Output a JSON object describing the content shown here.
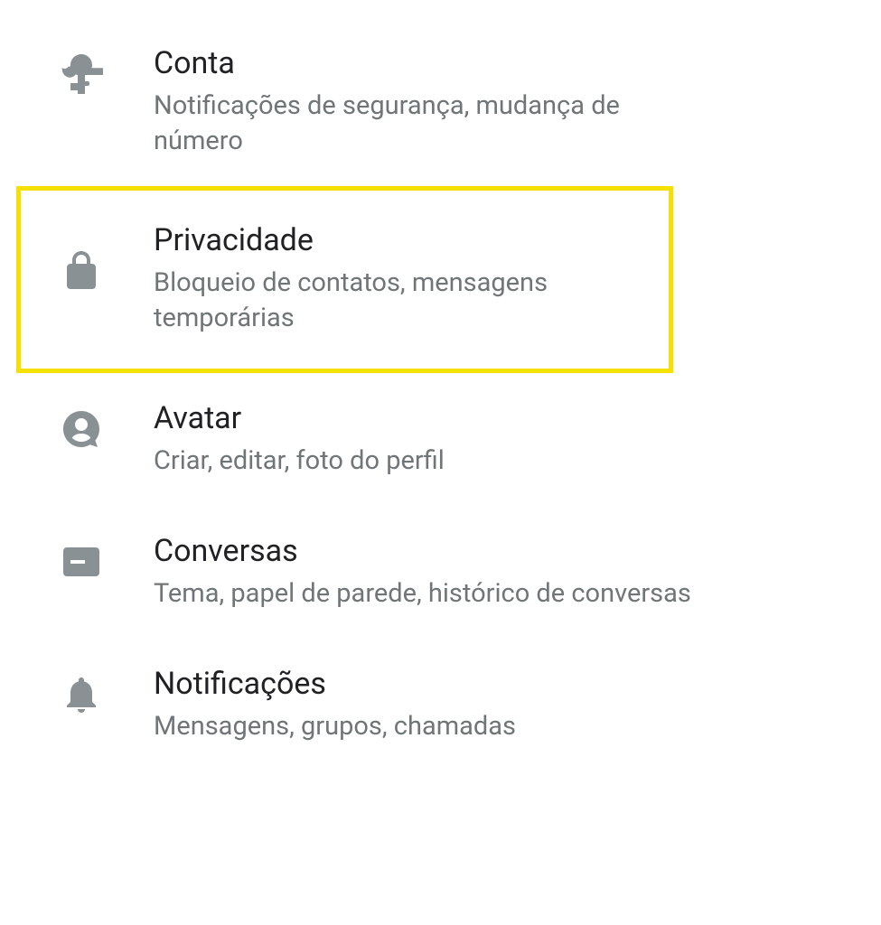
{
  "settings": {
    "items": [
      {
        "title": "Conta",
        "description": "Notificações de segurança, mudança de número",
        "icon": "key"
      },
      {
        "title": "Privacidade",
        "description": "Bloqueio de contatos, mensagens temporárias",
        "icon": "lock",
        "highlighted": true
      },
      {
        "title": "Avatar",
        "description": "Criar, editar, foto do perfil",
        "icon": "avatar"
      },
      {
        "title": "Conversas",
        "description": "Tema, papel de parede, histórico de conversas",
        "icon": "chat"
      },
      {
        "title": "Notificações",
        "description": "Mensagens, grupos, chamadas",
        "icon": "bell"
      }
    ]
  }
}
